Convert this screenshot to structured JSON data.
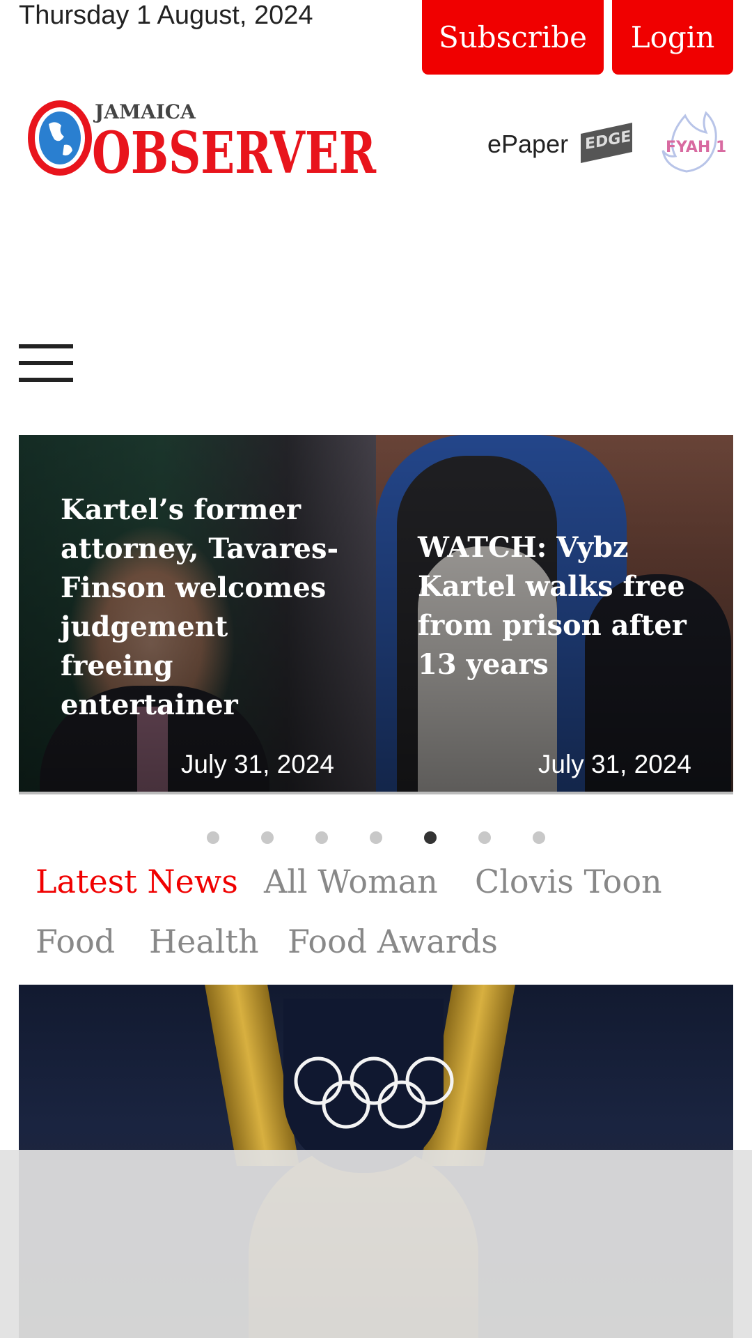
{
  "header": {
    "date": "Thursday 1 August, 2024",
    "subscribe_label": "Subscribe",
    "login_label": "Login"
  },
  "brand": {
    "logo_small": "JAMAICA",
    "logo_big": "OBSERVER",
    "epaper_label": "ePaper",
    "edge_logo": "EDGE 105",
    "fyah_logo": "FYAH 105"
  },
  "carousel": {
    "slides": [
      {
        "title": "Kartel’s former attorney, Tavares-Finson welcomes judgement freeing entertainer",
        "date": "July 31, 2024"
      },
      {
        "title": "WATCH: Vybz Kartel walks free from prison after 13 years",
        "date": "July 31, 2024"
      }
    ],
    "dot_count": 7,
    "active_dot": 5
  },
  "tabs": [
    {
      "label": "Latest News",
      "active": true
    },
    {
      "label": "All Woman",
      "active": false
    },
    {
      "label": "Clovis Toon",
      "active": false
    },
    {
      "label": "Food",
      "active": false
    },
    {
      "label": "Health",
      "active": false
    },
    {
      "label": "Food Awards",
      "active": false
    }
  ],
  "colors": {
    "brand_red": "#f00000",
    "tab_inactive": "#888888"
  }
}
